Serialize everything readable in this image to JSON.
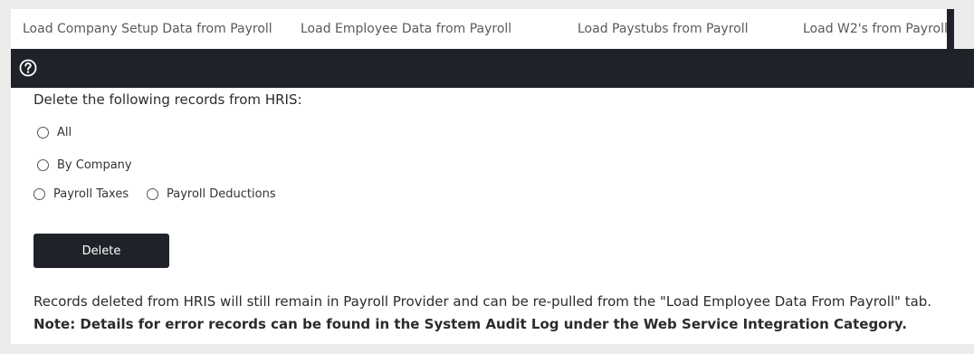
{
  "tabs": [
    {
      "label": "Load Company Setup Data from Payroll"
    },
    {
      "label": "Load Employee Data from Payroll"
    },
    {
      "label": "Load Paystubs from Payroll"
    },
    {
      "label": "Load W2's from Payroll"
    }
  ],
  "toolbar": {
    "help_icon": "question-circle-icon"
  },
  "form": {
    "heading": "Delete the following records from HRIS:",
    "options": {
      "all": "All",
      "by_company": "By Company",
      "payroll_taxes": "Payroll Taxes",
      "payroll_deductions": "Payroll Deductions"
    },
    "delete_label": "Delete"
  },
  "info": {
    "text": "Records deleted from HRIS will still remain in Payroll Provider and can be re-pulled from the \"Load Employee Data From Payroll\" tab.",
    "note": "Note: Details for error records can be found in the System Audit Log under the Web Service Integration Category."
  },
  "colors": {
    "dark_bar": "#1f2329",
    "background": "#ececec"
  }
}
